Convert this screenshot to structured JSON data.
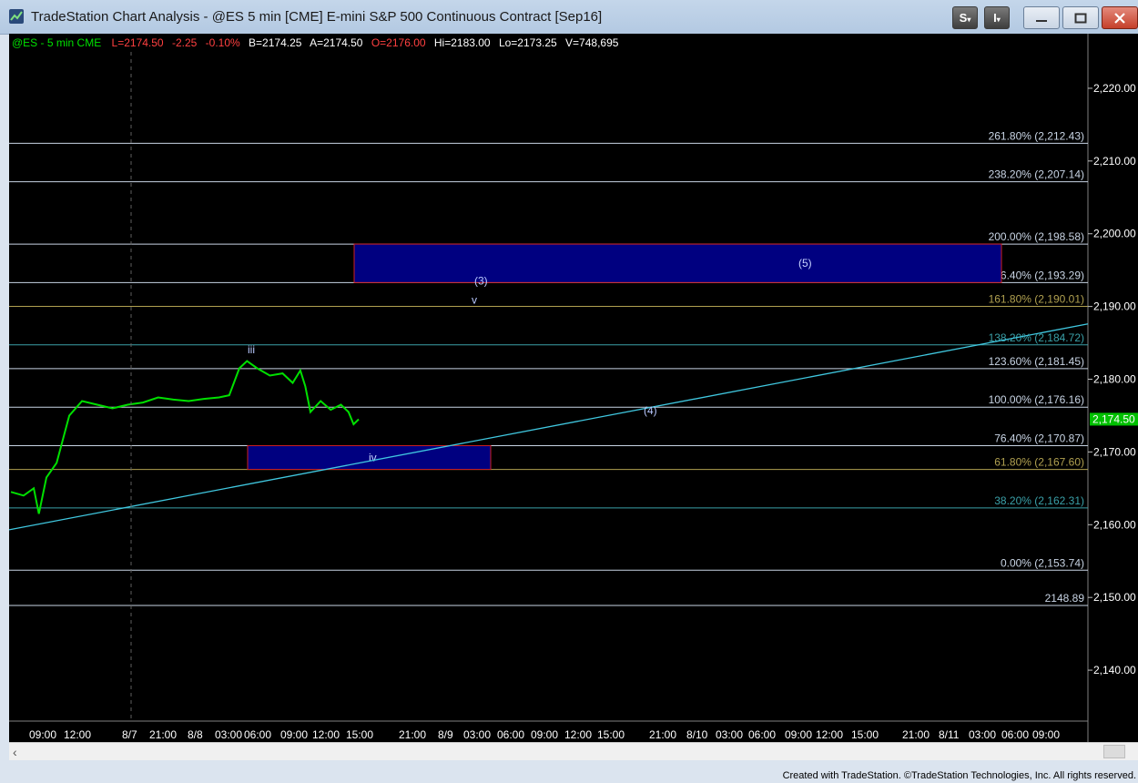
{
  "window": {
    "title": "TradeStation Chart Analysis - @ES 5 min [CME] E-mini S&P 500 Continuous Contract [Sep16]",
    "s_button": "S",
    "i_button": "I",
    "minimize_icon": "minimize-icon",
    "maximize_icon": "maximize-icon",
    "close_icon": "close-icon"
  },
  "info_bar": {
    "symbol": "@ES - 5 min  CME",
    "last": "L=2174.50",
    "change": "-2.25",
    "change_pct": "-0.10%",
    "bid": "B=2174.25",
    "ask": "A=2174.50",
    "open": "O=2176.00",
    "high": "Hi=2183.00",
    "low": "Lo=2173.25",
    "volume": "V=748,695"
  },
  "colors": {
    "background": "#000000",
    "price": "#00e000",
    "last_badge": "#00c000",
    "fib_white": "#c8d4e4",
    "fib_olive": "#b0a050",
    "fib_teal": "#3aa0a8",
    "zone_fill": "#000080",
    "zone_border": "#d02020",
    "trendline": "#40c8e0",
    "negative": "#ff4040",
    "open": "#ff4040"
  },
  "footer": "Created with TradeStation. ©TradeStation Technologies, Inc. All rights reserved.",
  "chart_data": {
    "type": "line",
    "ylim": [
      2133,
      2225
    ],
    "y_ticks": [
      "2,220.00",
      "2,210.00",
      "2,200.00",
      "2,190.00",
      "2,180.00",
      "2,170.00",
      "2,160.00",
      "2,150.00",
      "2,140.00"
    ],
    "y_tick_values": [
      2220,
      2210,
      2200,
      2190,
      2180,
      2170,
      2160,
      2150,
      2140
    ],
    "x_ticks": [
      "09:00",
      "12:00",
      "8/7",
      "21:00",
      "8/8",
      "03:00",
      "06:00",
      "09:00",
      "12:00",
      "15:00",
      "21:00",
      "8/9",
      "03:00",
      "06:00",
      "09:00",
      "12:00",
      "15:00",
      "21:00",
      "8/10",
      "03:00",
      "06:00",
      "09:00",
      "12:00",
      "15:00",
      "21:00",
      "8/11",
      "03:00",
      "06:00",
      "09:00"
    ],
    "last_price_label": "2,174.50",
    "last_price": 2174.5,
    "fib_levels": [
      {
        "label": "261.80% (2,212.43)",
        "value": 2212.43,
        "color": "white"
      },
      {
        "label": "238.20% (2,207.14)",
        "value": 2207.14,
        "color": "white"
      },
      {
        "label": "200.00% (2,198.58)",
        "value": 2198.58,
        "color": "white"
      },
      {
        "label": "176.40% (2,193.29)",
        "value": 2193.29,
        "color": "white"
      },
      {
        "label": "161.80% (2,190.01)",
        "value": 2190.01,
        "color": "olive"
      },
      {
        "label": "138.20% (2,184.72)",
        "value": 2184.72,
        "color": "teal"
      },
      {
        "label": "123.60% (2,181.45)",
        "value": 2181.45,
        "color": "white"
      },
      {
        "label": "100.00% (2,176.16)",
        "value": 2176.16,
        "color": "white"
      },
      {
        "label": "76.40% (2,170.87)",
        "value": 2170.87,
        "color": "white"
      },
      {
        "label": "61.80% (2,167.60)",
        "value": 2167.6,
        "color": "olive"
      },
      {
        "label": "38.20% (2,162.31)",
        "value": 2162.31,
        "color": "teal"
      },
      {
        "label": "0.00% (2,153.74)",
        "value": 2153.74,
        "color": "white"
      },
      {
        "label": "2148.89",
        "value": 2148.89,
        "color": "white"
      }
    ],
    "zones": [
      {
        "label": "(5)",
        "top": 2198.58,
        "bottom": 2193.29
      },
      {
        "label": "iv",
        "top": 2170.87,
        "bottom": 2167.6
      }
    ],
    "wave_labels": [
      "iii",
      "(3)",
      "v",
      "(4)"
    ],
    "price_series": [
      {
        "t": 0.0,
        "v": 2164.5
      },
      {
        "t": 0.05,
        "v": 2164.0
      },
      {
        "t": 0.09,
        "v": 2165.0
      },
      {
        "t": 0.11,
        "v": 2161.5
      },
      {
        "t": 0.14,
        "v": 2166.5
      },
      {
        "t": 0.18,
        "v": 2168.5
      },
      {
        "t": 0.23,
        "v": 2175.0
      },
      {
        "t": 0.28,
        "v": 2177.0
      },
      {
        "t": 0.34,
        "v": 2176.5
      },
      {
        "t": 0.4,
        "v": 2176.0
      },
      {
        "t": 0.46,
        "v": 2176.5
      },
      {
        "t": 0.52,
        "v": 2176.8
      },
      {
        "t": 0.58,
        "v": 2177.5
      },
      {
        "t": 0.64,
        "v": 2177.2
      },
      {
        "t": 0.7,
        "v": 2177.0
      },
      {
        "t": 0.76,
        "v": 2177.3
      },
      {
        "t": 0.82,
        "v": 2177.5
      },
      {
        "t": 0.86,
        "v": 2177.8
      },
      {
        "t": 0.9,
        "v": 2181.5
      },
      {
        "t": 0.93,
        "v": 2182.5
      },
      {
        "t": 0.97,
        "v": 2181.5
      },
      {
        "t": 1.02,
        "v": 2180.5
      },
      {
        "t": 1.07,
        "v": 2180.8
      },
      {
        "t": 1.11,
        "v": 2179.5
      },
      {
        "t": 1.14,
        "v": 2181.2
      },
      {
        "t": 1.16,
        "v": 2179.0
      },
      {
        "t": 1.18,
        "v": 2175.5
      },
      {
        "t": 1.22,
        "v": 2177.0
      },
      {
        "t": 1.26,
        "v": 2175.8
      },
      {
        "t": 1.3,
        "v": 2176.5
      },
      {
        "t": 1.33,
        "v": 2175.5
      },
      {
        "t": 1.35,
        "v": 2173.8
      },
      {
        "t": 1.37,
        "v": 2174.5
      }
    ]
  }
}
